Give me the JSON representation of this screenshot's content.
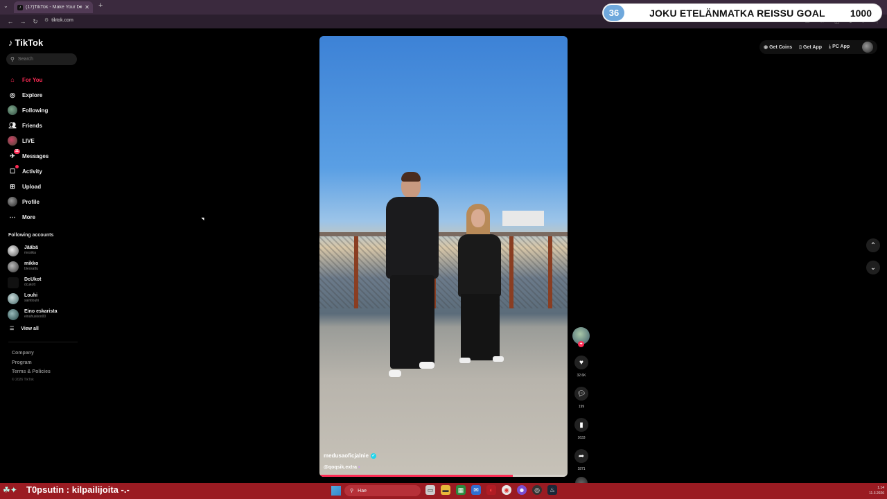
{
  "browser": {
    "tab_title": "(17)TikTok - Make Your Day",
    "new_tab": "+",
    "url": "tiktok.com"
  },
  "overlay_goal": {
    "count": "36",
    "title": "JOKU ETELÄNMATKA REISSU GOAL",
    "target": "1000"
  },
  "app": {
    "name": "TikTok"
  },
  "search": {
    "placeholder": "Search"
  },
  "nav": {
    "items": [
      {
        "label": "For You",
        "icon": "home-icon",
        "active": true
      },
      {
        "label": "Explore",
        "icon": "compass-icon"
      },
      {
        "label": "Following",
        "icon": "avatar"
      },
      {
        "label": "Friends",
        "icon": "friends-icon"
      },
      {
        "label": "LIVE",
        "icon": "avatar"
      },
      {
        "label": "Messages",
        "icon": "message-icon",
        "badge": "11"
      },
      {
        "label": "Activity",
        "icon": "inbox-icon",
        "dot": true
      },
      {
        "label": "Upload",
        "icon": "plus-square-icon"
      },
      {
        "label": "Profile",
        "icon": "avatar"
      },
      {
        "label": "More",
        "icon": "more-icon"
      }
    ]
  },
  "following_accounts": {
    "title": "Following accounts",
    "items": [
      {
        "name": "Jääbä",
        "handle": "mosiika"
      },
      {
        "name": "mikko",
        "handle": "blessattu"
      },
      {
        "name": "DcUkot",
        "handle": "dcukott"
      },
      {
        "name": "Louhi",
        "handle": "saintlouhi"
      },
      {
        "name": "Eino eskarista",
        "handle": "einahuskoo00"
      }
    ],
    "view_all": "View all"
  },
  "footer": {
    "links": [
      "Company",
      "Program",
      "Terms & Policies"
    ],
    "copyright": "© 2026 TikTok"
  },
  "video": {
    "author": "medusaoficjalnie",
    "tag": "@qoqsik.extra",
    "progress": 0.78
  },
  "actions": {
    "likes": "32.6K",
    "comments": "199",
    "saves": "1633",
    "shares": "1871"
  },
  "top_right": {
    "get_coins": "Get Coins",
    "get_app": "Get App",
    "pc_app": "PC App"
  },
  "taskbar": {
    "ticker": "T0psutin : kilpailijoita -.-",
    "search_placeholder": "Hae",
    "time": "1.14",
    "date": "11.3.2026"
  }
}
